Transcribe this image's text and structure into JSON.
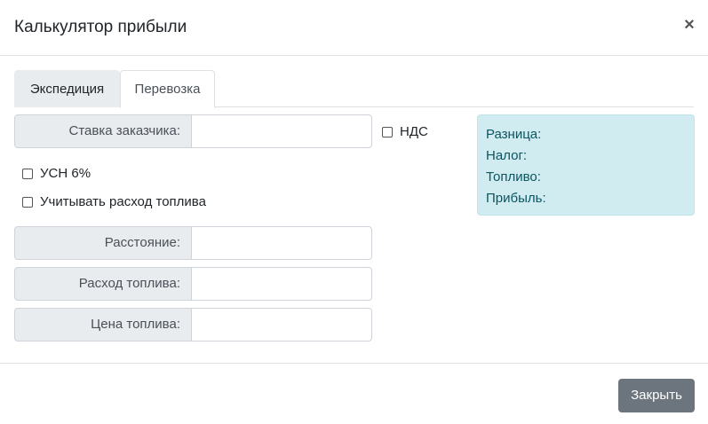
{
  "modal": {
    "title": "Калькулятор прибыли",
    "close_symbol": "×"
  },
  "tabs": [
    {
      "label": "Экспедиция",
      "active": false
    },
    {
      "label": "Перевозка",
      "active": true
    }
  ],
  "form": {
    "customer_rate": {
      "label": "Ставка заказчика:",
      "value": ""
    },
    "vat": {
      "label": "НДС",
      "checked": false
    },
    "usn": {
      "label": "УСН 6%",
      "checked": false
    },
    "fuel_consider": {
      "label": "Учитывать расход топлива",
      "checked": false
    },
    "distance": {
      "label": "Расстояние:",
      "value": ""
    },
    "fuel_consumption": {
      "label": "Расход топлива:",
      "value": ""
    },
    "fuel_price": {
      "label": "Цена топлива:",
      "value": ""
    }
  },
  "results": {
    "difference": "Разница:",
    "tax": "Налог:",
    "fuel": "Топливо:",
    "profit": "Прибыль:"
  },
  "footer": {
    "close_label": "Закрыть"
  },
  "colors": {
    "result_bg": "#d1ecf1",
    "result_text": "#0c5460",
    "button_secondary": "#6c757d"
  }
}
